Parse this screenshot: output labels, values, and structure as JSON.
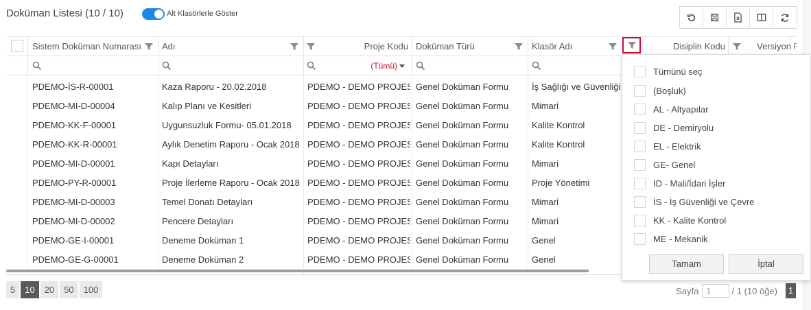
{
  "header": {
    "title": "Doküman Listesi (10 / 10)",
    "toggle_label": "Alt Klasörlerle Göster"
  },
  "toolbar": [
    "undo-icon",
    "save-icon",
    "excel-export-icon",
    "columns-icon",
    "refresh-icon"
  ],
  "columns": {
    "doc_no": "Sistem Doküman Numarası",
    "name": "Adı",
    "project_code": "Proje Kodu",
    "doc_type": "Doküman Türü",
    "folder": "Klasör Adı",
    "discipline": "Disiplin Kodu",
    "version": "Versiyon",
    "next": "R"
  },
  "filters": {
    "project_code_value": "(Tümü)"
  },
  "rows": [
    {
      "doc_no": "PDEMO-İS-R-00001",
      "name": "Kaza Raporu - 20.02.2018",
      "project": "PDEMO - DEMO PROJESİ",
      "type": "Genel Doküman Formu",
      "folder": "İş Sağlığı ve Güvenliği"
    },
    {
      "doc_no": "PDEMO-MI-D-00004",
      "name": "Kalıp Planı ve Kesitleri",
      "project": "PDEMO - DEMO PROJESİ",
      "type": "Genel Doküman Formu",
      "folder": "Mimari"
    },
    {
      "doc_no": "PDEMO-KK-F-00001",
      "name": "Uygunsuzluk Formu- 05.01.2018",
      "project": "PDEMO - DEMO PROJESİ",
      "type": "Genel Doküman Formu",
      "folder": "Kalite Kontrol"
    },
    {
      "doc_no": "PDEMO-KK-R-00001",
      "name": "Aylık Denetim Raporu - Ocak 2018",
      "project": "PDEMO - DEMO PROJESİ",
      "type": "Genel Doküman Formu",
      "folder": "Kalite Kontrol"
    },
    {
      "doc_no": "PDEMO-MI-D-00001",
      "name": "Kapı Detayları",
      "project": "PDEMO - DEMO PROJESİ",
      "type": "Genel Doküman Formu",
      "folder": "Mimari"
    },
    {
      "doc_no": "PDEMO-PY-R-00001",
      "name": "Proje İlerleme Raporu - Ocak 2018",
      "project": "PDEMO - DEMO PROJESİ",
      "type": "Genel Doküman Formu",
      "folder": "Proje Yönetimi"
    },
    {
      "doc_no": "PDEMO-MI-D-00003",
      "name": "Temel Donatı Detayları",
      "project": "PDEMO - DEMO PROJESİ",
      "type": "Genel Doküman Formu",
      "folder": "Mimari"
    },
    {
      "doc_no": "PDEMO-MI-D-00002",
      "name": "Pencere Detayları",
      "project": "PDEMO - DEMO PROJESİ",
      "type": "Genel Doküman Formu",
      "folder": "Mimari"
    },
    {
      "doc_no": "PDEMO-GE-I-00001",
      "name": "Deneme Doküman 1",
      "project": "PDEMO - DEMO PROJESİ",
      "type": "Genel Doküman Formu",
      "folder": "Genel"
    },
    {
      "doc_no": "PDEMO-GE-G-00001",
      "name": "Deneme Doküman 2",
      "project": "PDEMO - DEMO PROJESİ",
      "type": "Genel Doküman Formu",
      "folder": "Genel"
    }
  ],
  "pager": {
    "sizes": [
      "5",
      "10",
      "20",
      "50",
      "100"
    ],
    "active_size": "10",
    "page_label": "Sayfa",
    "page_value": "1",
    "total_label": "/ 1 (10 öğe)",
    "page_number": "1"
  },
  "filter_popup": {
    "options": [
      "Tümünü seç",
      "(Boşluk)",
      "AL - Altyapılar",
      "DE - Demiryolu",
      "EL - Elektrik",
      "GE- Genel",
      "ID - Mali/İdari İşler",
      "İS - İş Güvenliği ve Çevre",
      "KK - Kalite Kontrol",
      "ME - Mekanik"
    ],
    "ok_label": "Tamam",
    "cancel_label": "İptal"
  },
  "colors": {
    "accent": "#1e88e5",
    "highlight": "#c8102e",
    "filter_value": "#c8102e"
  }
}
